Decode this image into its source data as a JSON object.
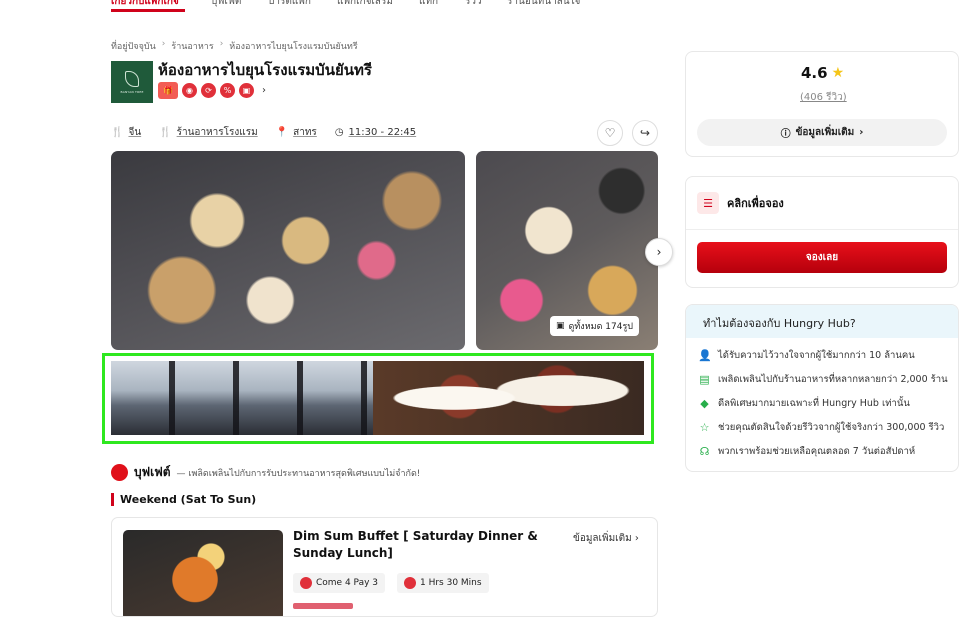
{
  "topnav": {
    "tabs": [
      "เกี่ยวกับแพ็กเกจ",
      "บุฟเฟต์",
      "ปาร์ตี้แพ็ก",
      "แพ็กเกจเสริม",
      "แท็ก",
      "รีวิว",
      "ร้านอื่นที่น่าสนใจ"
    ]
  },
  "breadcrumb": [
    "ที่อยู่ปัจจุบัน",
    "ร้านอาหาร",
    "ห้องอาหารไบยุนโรงแรมบันยันทรี"
  ],
  "restaurant": {
    "logo_text": "BANYAN TREE",
    "name": "ห้องอาหารไบยุนโรงแรมบันยันทรี",
    "cuisine": "จีน",
    "category": "ร้านอาหารโรงแรม",
    "location": "สาทร",
    "hours": "11:30 - 22:45"
  },
  "gallery": {
    "see_all": "ดูทั้งหมด 174รูป"
  },
  "buffet": {
    "title": "บุฟเฟต์",
    "desc": "— เพลิดเพลินไปกับการรับประทานอาหารสุดพิเศษแบบไม่จำกัด!",
    "section": "Weekend (Sat To Sun)"
  },
  "package": {
    "name": "Dim Sum Buffet [ Saturday Dinner & Sunday Lunch]",
    "more": "ข้อมูลเพิ่มเติม",
    "promo": "Come 4 Pay 3",
    "duration": "1 Hrs 30 Mins"
  },
  "rating": {
    "score": "4.6",
    "reviews": "(406 รีวิว)",
    "info_button": "ข้อมูลเพิ่มเติม"
  },
  "booking": {
    "title": "คลิกเพื่อจอง",
    "button": "จองเลย"
  },
  "why": {
    "title": "ทำไมต้องจองกับ Hungry Hub?",
    "items": [
      "ได้รับความไว้วางใจจากผู้ใช้มากกว่า 10 ล้านคน",
      "เพลิดเพลินไปกับร้านอาหารที่หลากหลายกว่า 2,000 ร้าน",
      "ดีลพิเศษมากมายเฉพาะที่ Hungry Hub เท่านั้น",
      "ช่วยคุณตัดสินใจด้วยรีวิวจากผู้ใช้จริงกว่า 300,000 รีวิว",
      "พวกเราพร้อมช่วยเหลือคุณตลอด 7 วันต่อสัปดาห์"
    ]
  }
}
